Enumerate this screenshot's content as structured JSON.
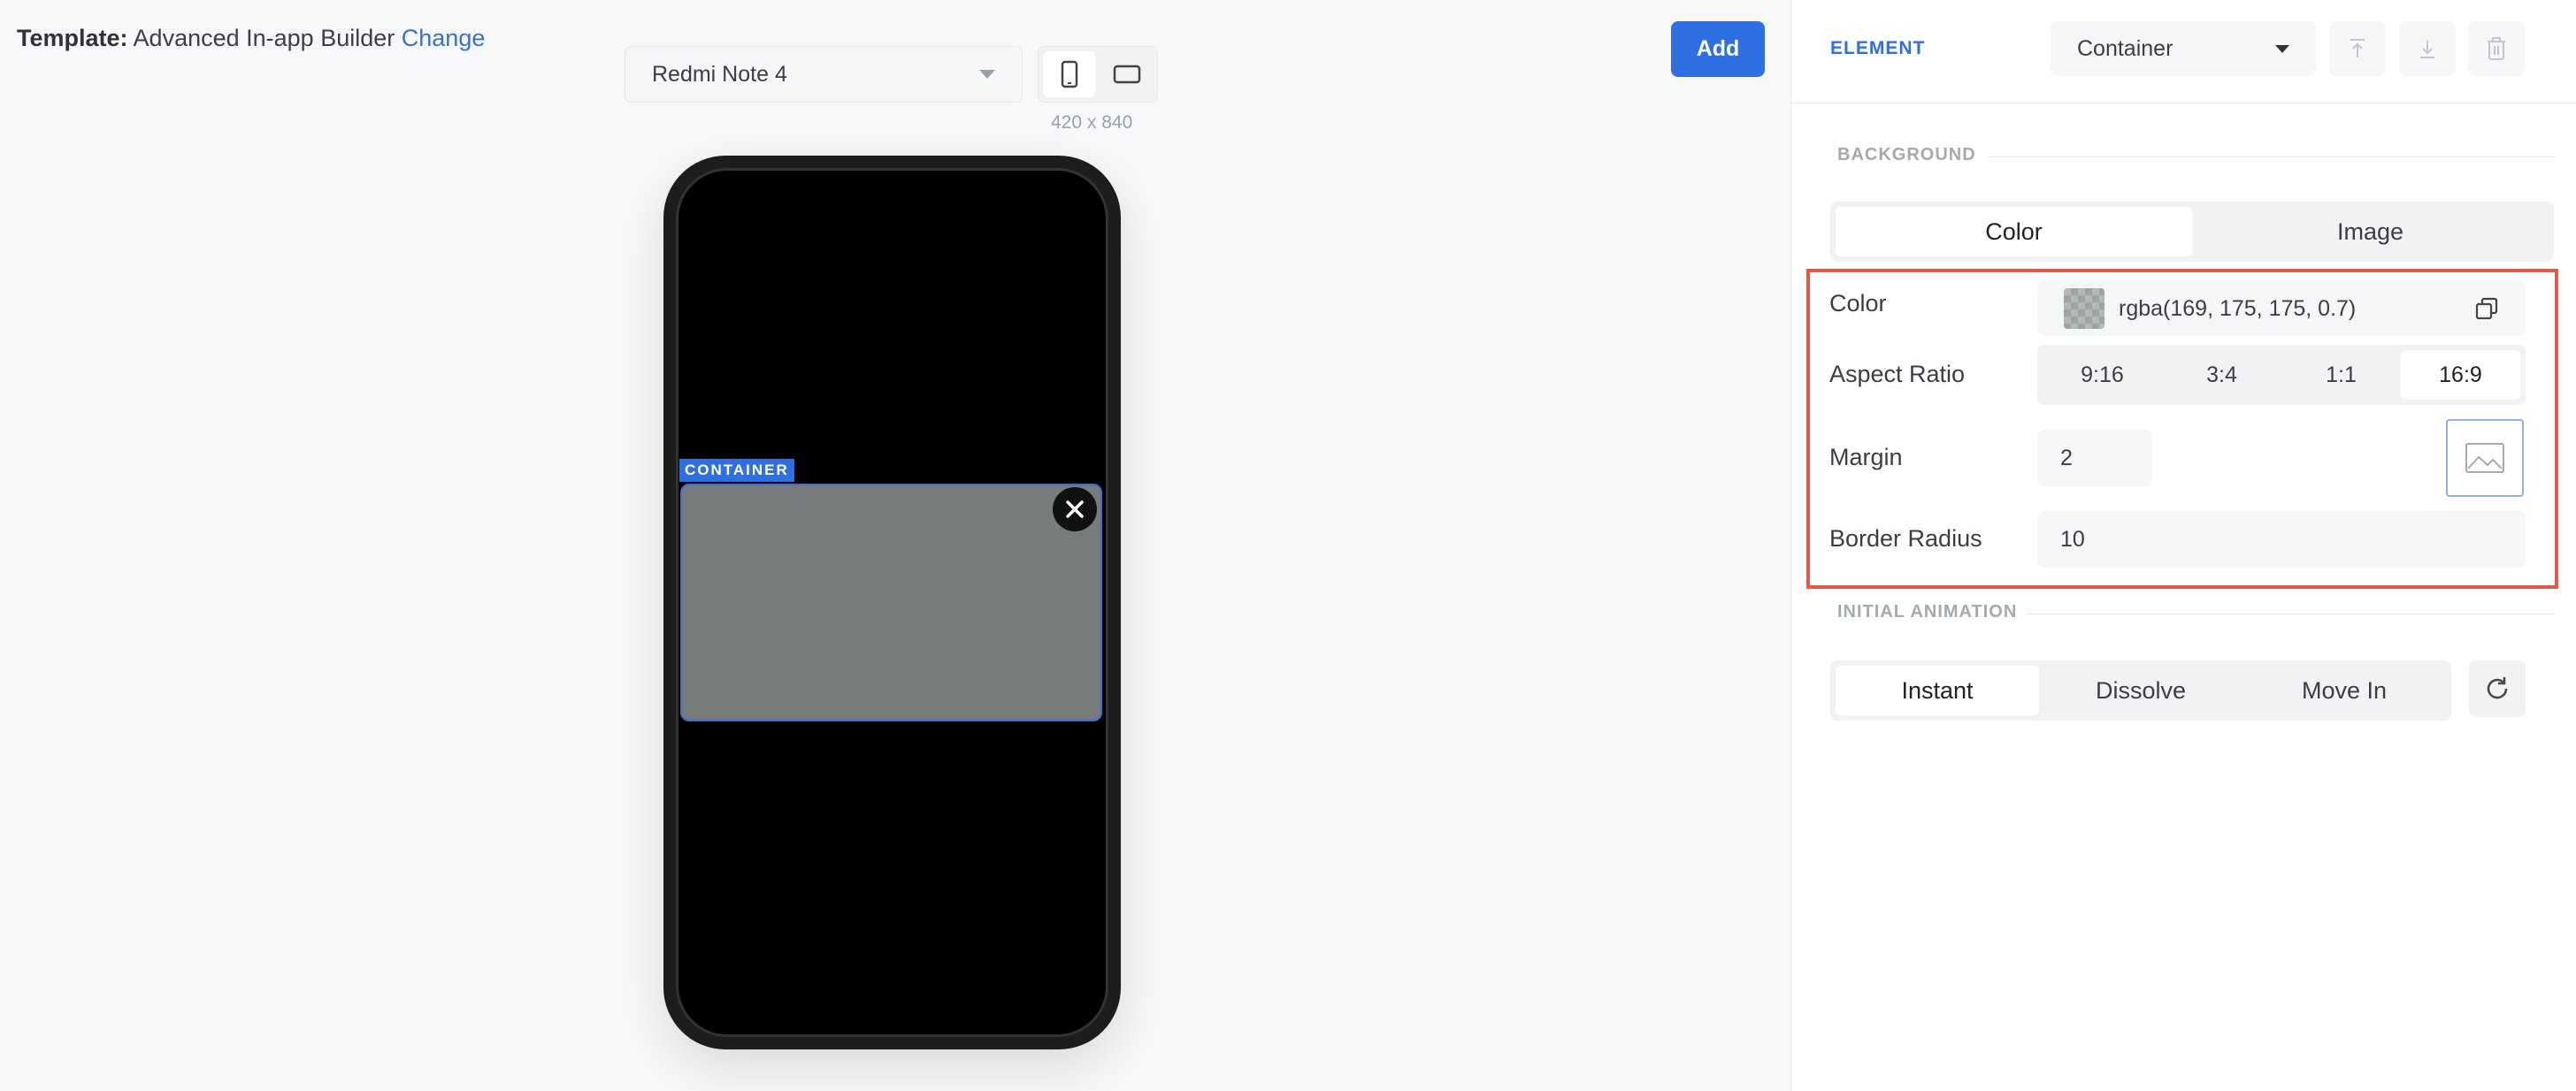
{
  "template": {
    "label": "Template:",
    "name": "Advanced In-app Builder",
    "change_link": "Change"
  },
  "toolbar": {
    "device": "Redmi Note 4",
    "dimensions": "420 x 840",
    "orientation_active": "portrait",
    "add_label": "Add"
  },
  "preview": {
    "container_tag": "CONTAINER",
    "container_color": "rgba(169,175,175,0.7)"
  },
  "panel": {
    "element_label": "ELEMENT",
    "element_type": "Container",
    "background": {
      "title": "BACKGROUND",
      "tabs": [
        {
          "label": "Color",
          "active": true
        },
        {
          "label": "Image",
          "active": false
        }
      ],
      "color_label": "Color",
      "color_value": "rgba(169, 175, 175, 0.7)",
      "aspect_ratio_label": "Aspect Ratio",
      "aspect_ratios": [
        {
          "label": "9:16",
          "active": false
        },
        {
          "label": "3:4",
          "active": false
        },
        {
          "label": "1:1",
          "active": false
        },
        {
          "label": "16:9",
          "active": true
        }
      ],
      "margin_label": "Margin",
      "margin_value": "2",
      "border_radius_label": "Border Radius",
      "border_radius_value": "10"
    },
    "animation": {
      "title": "INITIAL ANIMATION",
      "options": [
        {
          "label": "Instant",
          "active": true
        },
        {
          "label": "Dissolve",
          "active": false
        },
        {
          "label": "Move In",
          "active": false
        }
      ]
    }
  },
  "colors": {
    "accent": "#2f6fe4",
    "highlight": "#e2594a"
  }
}
